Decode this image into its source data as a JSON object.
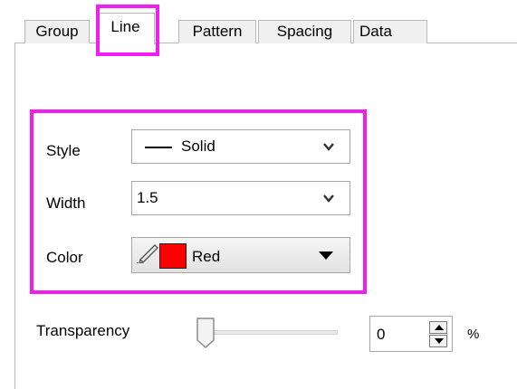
{
  "tabs": [
    {
      "label": "Group",
      "active": false
    },
    {
      "label": "Line",
      "active": true
    },
    {
      "label": "Pattern",
      "active": false
    },
    {
      "label": "Spacing",
      "active": false
    },
    {
      "label": "Data",
      "active": false
    }
  ],
  "line": {
    "style": {
      "label": "Style",
      "value": "Solid",
      "icon": "solid-line-icon"
    },
    "width": {
      "label": "Width",
      "value": "1.5"
    },
    "color": {
      "label": "Color",
      "value": "Red",
      "swatch": "#ff0000",
      "icon": "pencil-icon"
    }
  },
  "transparency": {
    "label": "Transparency",
    "value": "0",
    "unit": "%",
    "level": 0
  },
  "colors": {
    "highlight": "#f21df2"
  }
}
